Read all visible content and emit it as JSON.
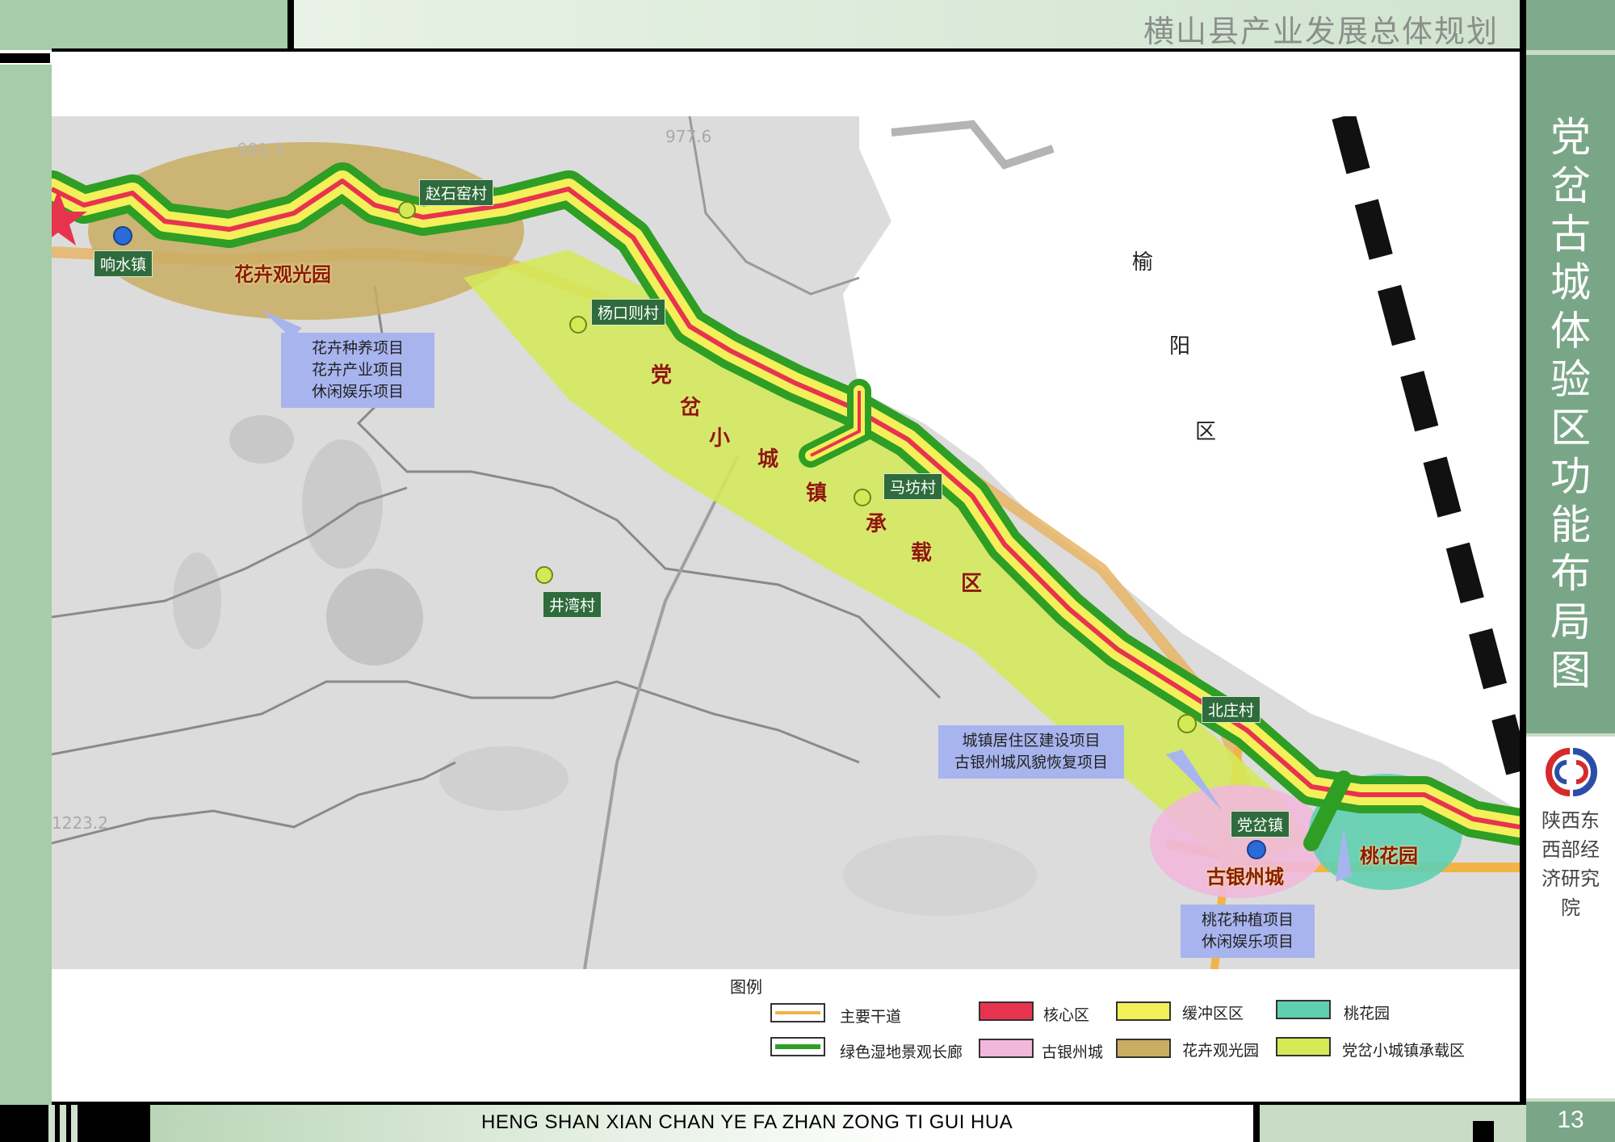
{
  "header": {
    "title": "横山县产业发展总体规划"
  },
  "side_title": "党岔古城体验区功能布局图",
  "institute": "陕西东西部经济研究院",
  "page_number": "13",
  "footer": {
    "pinyin": "HENG SHAN XIAN CHAN YE FA ZHAN ZONG TI GUI HUA"
  },
  "map": {
    "villages": {
      "zhaoshiyao": "赵石窑村",
      "yangkouze": "杨口则村",
      "mafang": "马坊村",
      "jingwan": "井湾村",
      "beizhuang": "北庄村"
    },
    "towns": {
      "xiangshui": "响水镇",
      "dangcha": "党岔镇"
    },
    "zones": {
      "flower_park": "花卉观光园",
      "peach_garden": "桃花园",
      "ancient_city": "古银州城",
      "small_town_chars": [
        "党",
        "岔",
        "小",
        "城",
        "镇",
        "承",
        "载",
        "区"
      ]
    },
    "region_chars": [
      "榆",
      "阳",
      "区"
    ],
    "callouts": {
      "flower": [
        "花卉种养项目",
        "花卉产业项目",
        "休闲娱乐项目"
      ],
      "town": [
        "城镇居住区建设项目",
        "古银州城风貌恢复项目"
      ],
      "peach": [
        "桃花种植项目",
        "休闲娱乐项目"
      ]
    },
    "elevation_labels": [
      "977.6",
      "991.3",
      "1223.2"
    ]
  },
  "legend": {
    "title": "图例",
    "items": [
      {
        "label": "主要干道",
        "color": "#f2b347"
      },
      {
        "label": "核心区",
        "color": "#e8334f"
      },
      {
        "label": "缓冲区区",
        "color": "#f3f05a"
      },
      {
        "label": "桃花园",
        "color": "#5fcfb0"
      },
      {
        "label": "绿色湿地景观长廊",
        "color": "#2e9e25"
      },
      {
        "label": "古银州城",
        "color": "#f1b8dc"
      },
      {
        "label": "花卉观光园",
        "color": "#c9ad62"
      },
      {
        "label": "党岔小城镇承载区",
        "color": "#d3ea56"
      }
    ]
  }
}
